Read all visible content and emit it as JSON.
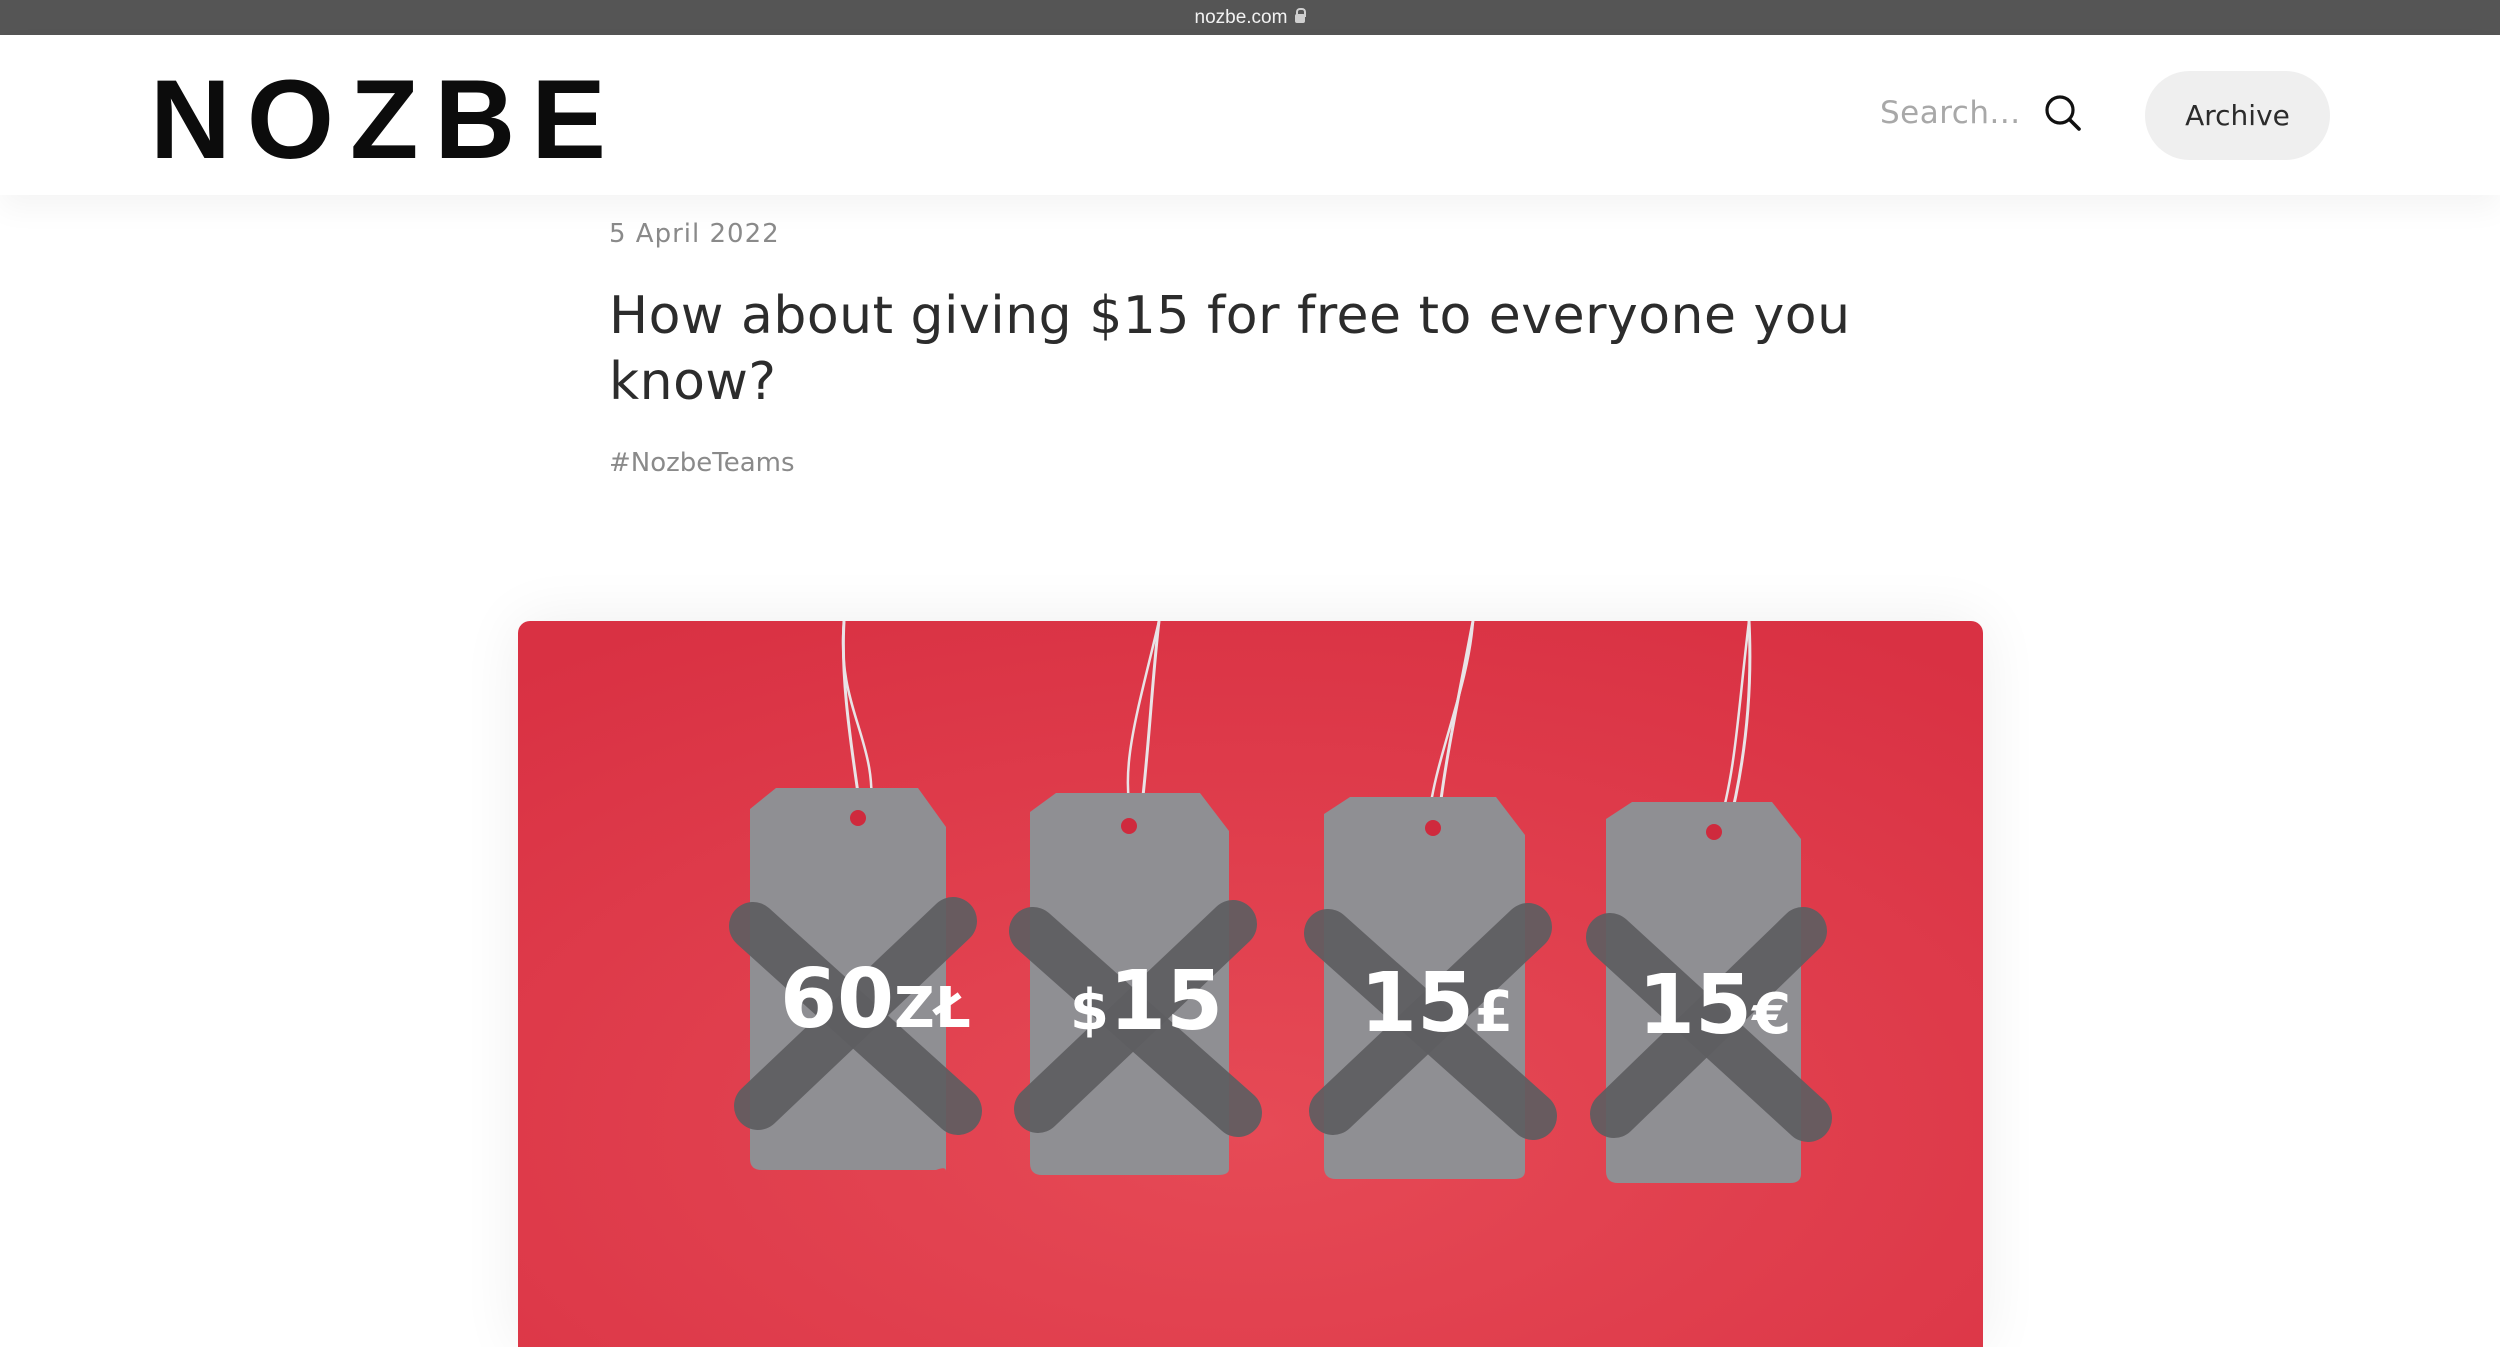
{
  "browser": {
    "url": "nozbe.com"
  },
  "header": {
    "logo": "NOZBE",
    "search_placeholder": "Search...",
    "archive_label": "Archive"
  },
  "post": {
    "date": "5 April 2022",
    "title": "How about giving $15 for free to everyone you know?",
    "tag": "#NozbeTeams",
    "image": {
      "background_color": "#dc3545",
      "tag_color": "#8f8f93",
      "cross_color": "#5e5e61",
      "tags": [
        {
          "amount": "60",
          "currency": "ZŁ"
        },
        {
          "currency_prefix": "$",
          "amount": "15"
        },
        {
          "amount": "15",
          "currency": "£"
        },
        {
          "amount": "15",
          "currency": "€"
        }
      ]
    }
  }
}
